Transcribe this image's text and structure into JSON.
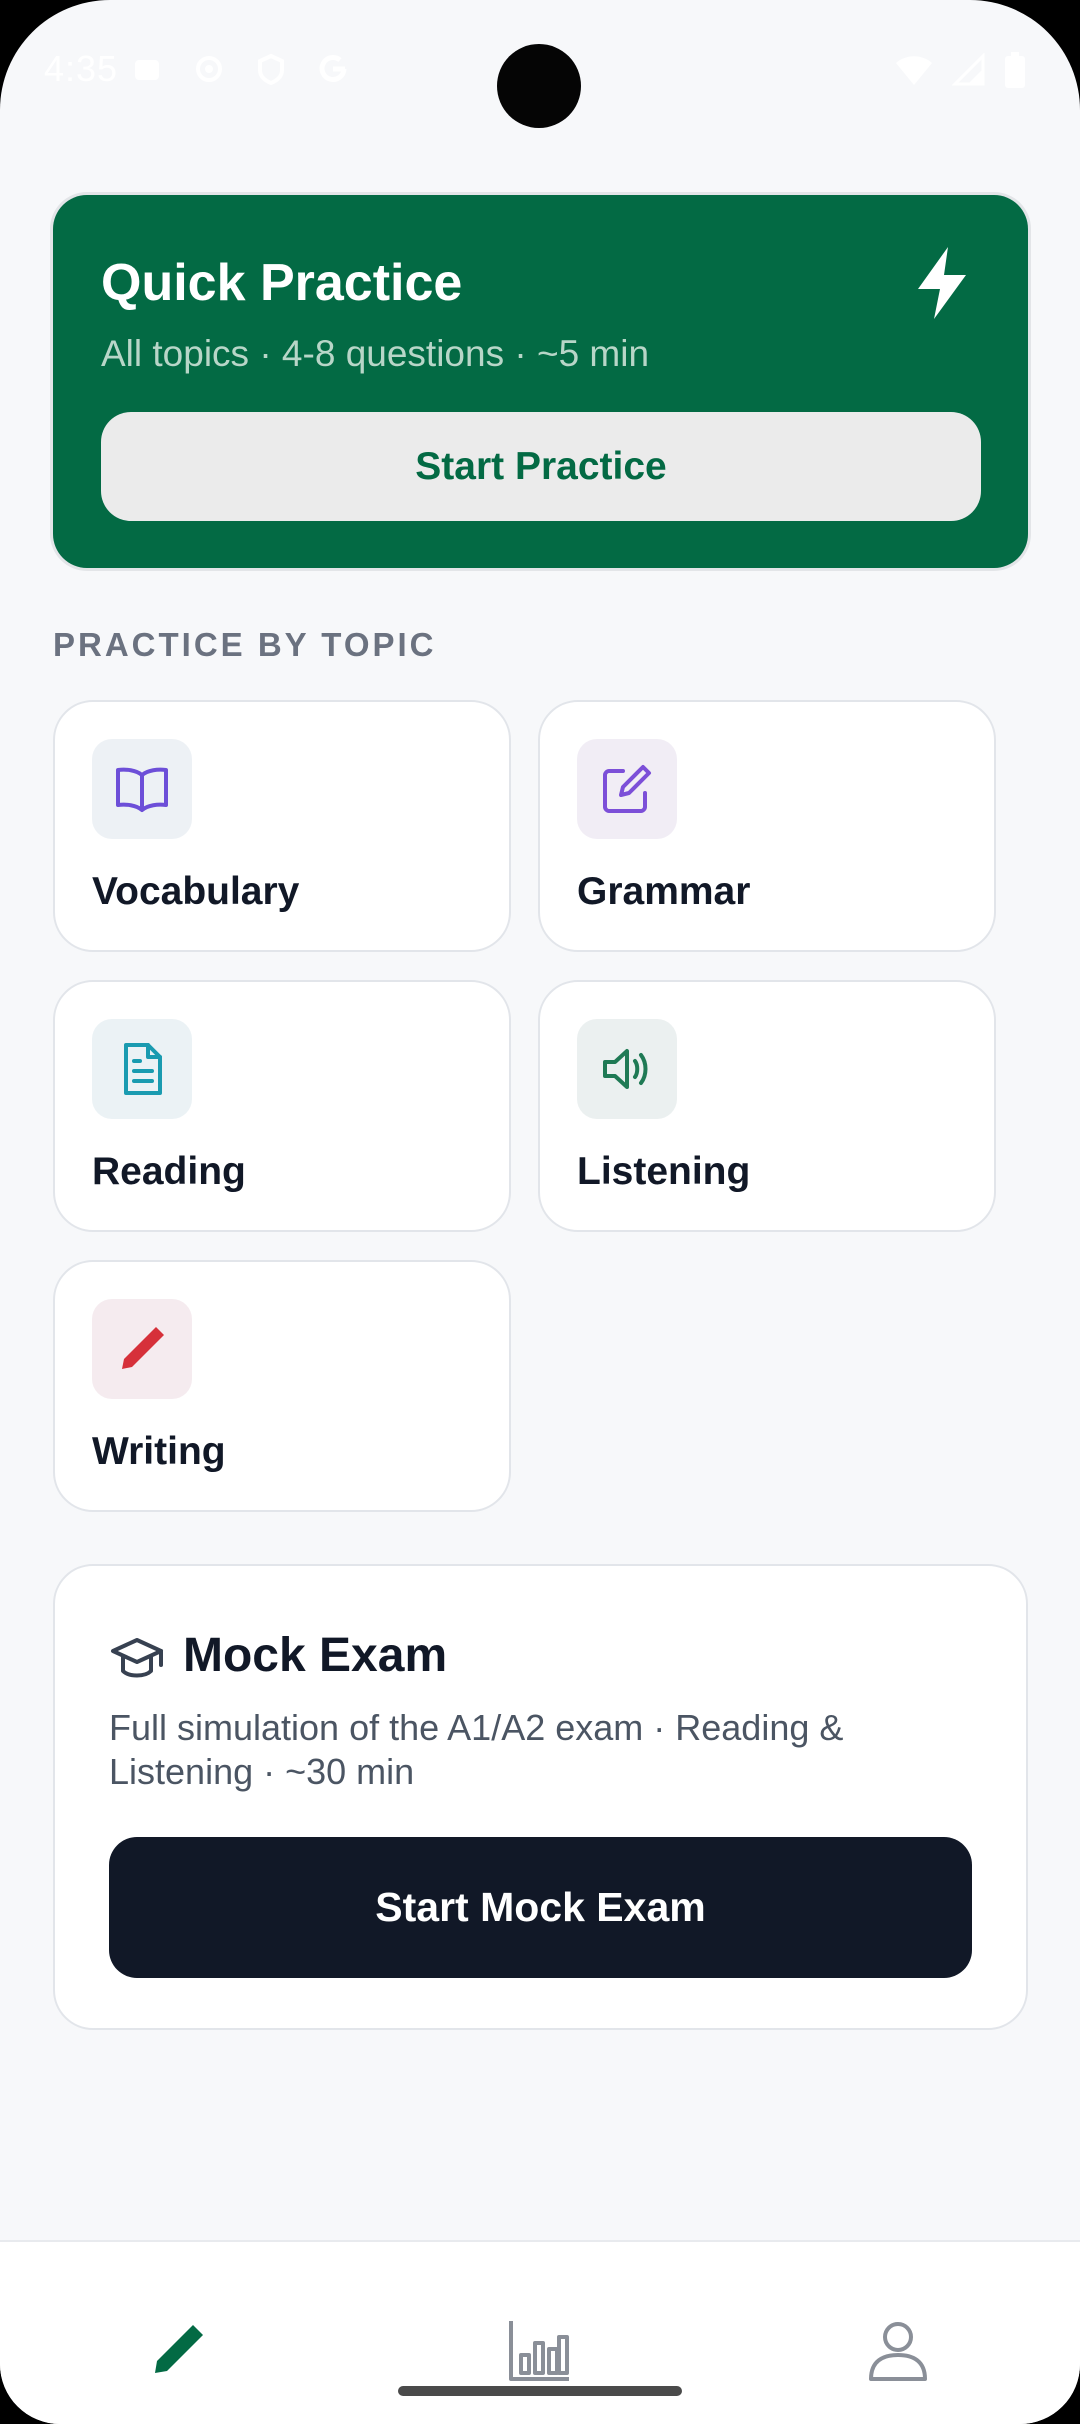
{
  "status_bar": {
    "time": "4:35"
  },
  "quick_practice": {
    "title": "Quick Practice",
    "subtitle": "All topics · 4-8 questions · ~5 min",
    "button_label": "Start Practice",
    "icon": "bolt-icon"
  },
  "topics": {
    "section_label": "PRACTICE BY TOPIC",
    "items": [
      {
        "label": "Vocabulary",
        "icon": "book-open-icon",
        "color": "#6d4fd8"
      },
      {
        "label": "Grammar",
        "icon": "edit-square-icon",
        "color": "#7c4fd8"
      },
      {
        "label": "Reading",
        "icon": "document-icon",
        "color": "#1a9bb0"
      },
      {
        "label": "Listening",
        "icon": "speaker-icon",
        "color": "#1f7a55"
      },
      {
        "label": "Writing",
        "icon": "pencil-icon",
        "color": "#d6303a"
      }
    ]
  },
  "mock_exam": {
    "title": "Mock Exam",
    "description": "Full simulation of the A1/A2 exam · Reading & Listening · ~30 min",
    "button_label": "Start Mock Exam",
    "icon": "graduation-cap-icon"
  },
  "bottom_nav": {
    "items": [
      {
        "name": "practice",
        "icon": "pencil-icon",
        "active": true
      },
      {
        "name": "stats",
        "icon": "bar-chart-icon",
        "active": false
      },
      {
        "name": "profile",
        "icon": "user-icon",
        "active": false
      }
    ]
  },
  "colors": {
    "brand_green": "#036a44",
    "dark_button": "#111827",
    "background": "#f7f8fa"
  }
}
